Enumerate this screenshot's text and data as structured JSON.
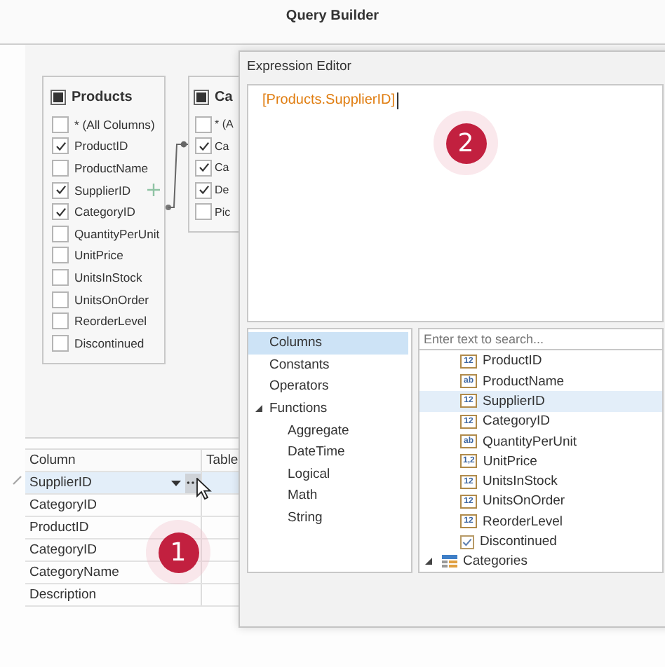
{
  "window": {
    "title": "Query Builder"
  },
  "tables": [
    {
      "name": "Products",
      "columns": [
        {
          "label": "* (All Columns)",
          "checked": false,
          "add_hint": false
        },
        {
          "label": "ProductID",
          "checked": true,
          "add_hint": false
        },
        {
          "label": "ProductName",
          "checked": false,
          "add_hint": false
        },
        {
          "label": "SupplierID",
          "checked": true,
          "add_hint": true
        },
        {
          "label": "CategoryID",
          "checked": true,
          "add_hint": false
        },
        {
          "label": "QuantityPerUnit",
          "checked": false,
          "add_hint": false
        },
        {
          "label": "UnitPrice",
          "checked": false,
          "add_hint": false
        },
        {
          "label": "UnitsInStock",
          "checked": false,
          "add_hint": false
        },
        {
          "label": "UnitsOnOrder",
          "checked": false,
          "add_hint": false
        },
        {
          "label": "ReorderLevel",
          "checked": false,
          "add_hint": false
        },
        {
          "label": "Discontinued",
          "checked": false,
          "add_hint": false
        }
      ]
    },
    {
      "name": "Ca",
      "columns": [
        {
          "label": "* (A",
          "checked": false,
          "add_hint": false
        },
        {
          "label": "Ca",
          "checked": true,
          "add_hint": false
        },
        {
          "label": "Ca",
          "checked": true,
          "add_hint": false
        },
        {
          "label": "De",
          "checked": true,
          "add_hint": false
        },
        {
          "label": "Pic",
          "checked": false,
          "add_hint": false
        }
      ]
    }
  ],
  "grid": {
    "columns": [
      "Column",
      "Table"
    ],
    "callout": "1",
    "rows": [
      {
        "column": "SupplierID",
        "selected": true
      },
      {
        "column": "CategoryID",
        "selected": false
      },
      {
        "column": "ProductID",
        "selected": false
      },
      {
        "column": "CategoryID",
        "selected": false
      },
      {
        "column": "CategoryName",
        "selected": false
      },
      {
        "column": "Description",
        "selected": false
      }
    ]
  },
  "expression_editor": {
    "title": "Expression Editor",
    "expression": "[Products.SupplierID]",
    "callout": "2",
    "categories": [
      {
        "label": "Columns",
        "selected": true
      },
      {
        "label": "Constants",
        "selected": false
      },
      {
        "label": "Operators",
        "selected": false
      },
      {
        "label": "Functions",
        "selected": false,
        "expanded": true,
        "children": [
          {
            "label": "Aggregate",
            "selected": false
          },
          {
            "label": "DateTime",
            "selected": false
          },
          {
            "label": "Logical",
            "selected": false
          },
          {
            "label": "Math",
            "selected": false
          },
          {
            "label": "String",
            "selected": false
          }
        ]
      }
    ],
    "search": {
      "placeholder": "Enter text to search..."
    },
    "fields": [
      {
        "label": "ProductID",
        "kind": "badge",
        "badge": "12",
        "selected": false
      },
      {
        "label": "ProductName",
        "kind": "badge",
        "badge": "ab",
        "selected": false
      },
      {
        "label": "SupplierID",
        "kind": "badge",
        "badge": "12",
        "selected": true
      },
      {
        "label": "CategoryID",
        "kind": "badge",
        "badge": "12",
        "selected": false
      },
      {
        "label": "QuantityPerUnit",
        "kind": "badge",
        "badge": "ab",
        "selected": false
      },
      {
        "label": "UnitPrice",
        "kind": "badge",
        "badge": "1,2",
        "selected": false
      },
      {
        "label": "UnitsInStock",
        "kind": "badge",
        "badge": "12",
        "selected": false
      },
      {
        "label": "UnitsOnOrder",
        "kind": "badge",
        "badge": "12",
        "selected": false
      },
      {
        "label": "ReorderLevel",
        "kind": "badge",
        "badge": "12",
        "selected": false
      },
      {
        "label": "Discontinued",
        "kind": "bool",
        "selected": false
      }
    ],
    "group": {
      "label": "Categories",
      "expanded": true
    }
  }
}
